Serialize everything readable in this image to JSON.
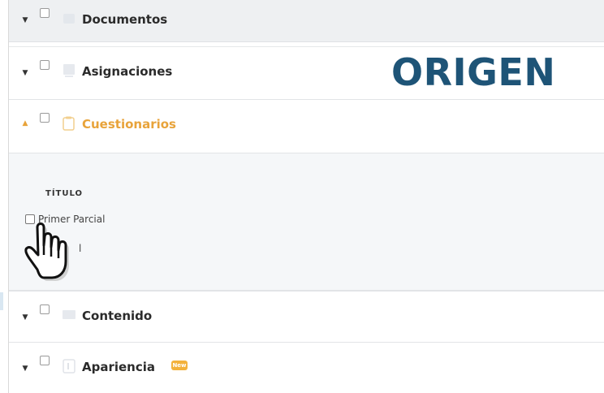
{
  "sections": [
    {
      "label": "Documentos",
      "expanded": false,
      "icon": "document-icon"
    },
    {
      "label": "Asignaciones",
      "expanded": false,
      "icon": "assignment-icon"
    },
    {
      "label": "Cuestionarios",
      "expanded": true,
      "icon": "quiz-icon"
    },
    {
      "label": "Contenido",
      "expanded": false,
      "icon": "content-icon"
    },
    {
      "label": "Apariencia",
      "expanded": false,
      "icon": "appearance-icon"
    }
  ],
  "quiz_table": {
    "column_header": "TÍTULO",
    "items": [
      "Primer Parcial",
      "l"
    ]
  },
  "overlay_label": "ORIGEN",
  "badge": "New",
  "colors": {
    "accent": "#e8a33a",
    "overlay_text": "#1e5477",
    "row_header_bg": "#eef0f2",
    "expanded_bg": "#f5f7f9"
  }
}
